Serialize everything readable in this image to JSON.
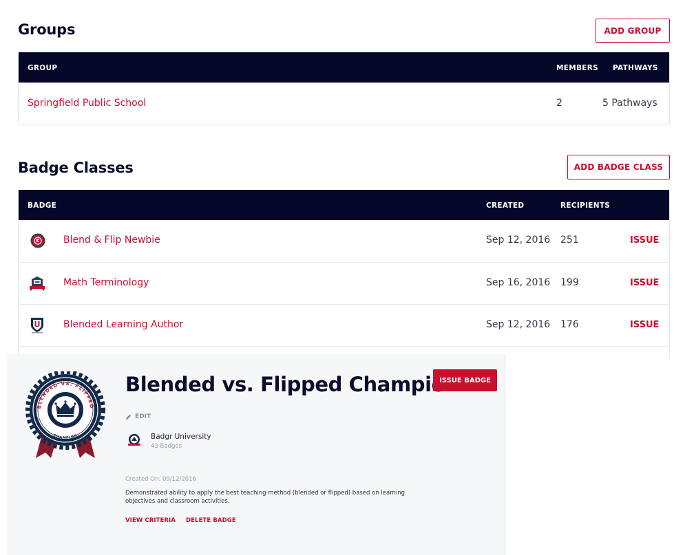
{
  "groups": {
    "title": "Groups",
    "add_button": "ADD GROUP",
    "headers": {
      "group": "GROUP",
      "members": "MEMBERS",
      "pathways": "PATHWAYS"
    },
    "rows": [
      {
        "name": "Springfield Public School",
        "members": "2",
        "pathways": "5 Pathways"
      }
    ]
  },
  "badge_classes": {
    "title": "Badge Classes",
    "add_button": "ADD BADGE CLASS",
    "headers": {
      "badge": "BADGE",
      "created": "CREATED",
      "recipients": "RECIPIENTS"
    },
    "rows": [
      {
        "name": "Blend & Flip Newbie",
        "created": "Sep 12, 2016",
        "recipients": "251",
        "action": "ISSUE",
        "icon": "badge-newbie-icon"
      },
      {
        "name": "Math Terminology",
        "created": "Sep 16, 2016",
        "recipients": "199",
        "action": "ISSUE",
        "icon": "badge-math-icon"
      },
      {
        "name": "Blended Learning Author",
        "created": "Sep 12, 2016",
        "recipients": "176",
        "action": "ISSUE",
        "icon": "badge-author-icon"
      }
    ]
  },
  "detail": {
    "title": "Blended vs. Flipped Champion",
    "issue_button": "ISSUE BADGE",
    "edit_label": "EDIT",
    "issuer_name": "Badgr University",
    "issuer_badges": "43 Badges",
    "created_on": "Created On: 09/12/2016",
    "description": "Demonstrated ability to apply the best teaching method (blended or flipped) based on learning objectives and classroom activities.",
    "view_criteria": "VIEW CRITERIA",
    "delete_badge": "DELETE BADGE",
    "badge_ring_text": "BLENDED VS. FLIPPED",
    "badge_bottom_text": "CHAMPION"
  },
  "colors": {
    "accent": "#c8102e",
    "header_bg": "#050728",
    "title_text": "#0b0d2b",
    "badge_navy": "#12294a",
    "ribbon": "#8b1a2b"
  }
}
